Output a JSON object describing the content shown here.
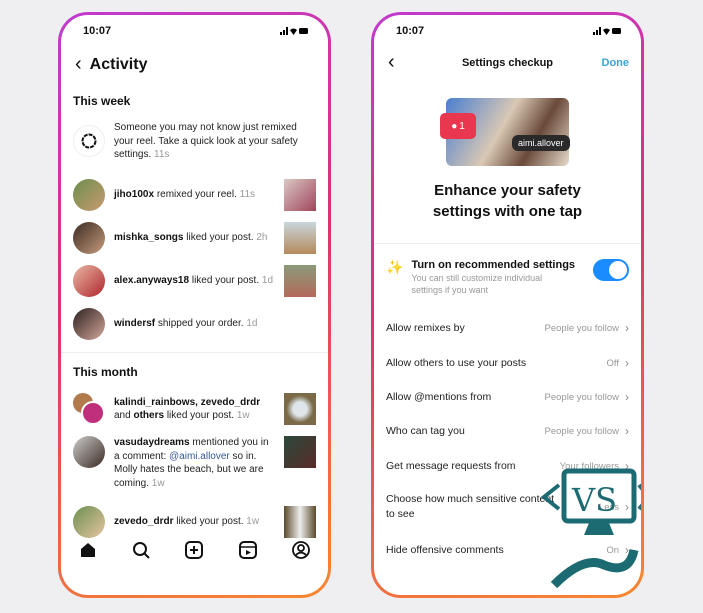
{
  "left": {
    "time": "10:07",
    "title": "Activity",
    "this_week": "This week",
    "items_week": [
      {
        "user": "",
        "text": "Someone you may not know just remixed your reel. Take a quick look at your safety settings.",
        "time": "11s"
      },
      {
        "user": "jiho100x",
        "text": "remixed your reel.",
        "time": "11s"
      },
      {
        "user": "mishka_songs",
        "text": "liked your post.",
        "time": "2h"
      },
      {
        "user": "alex.anyways18",
        "text": "liked your post.",
        "time": "1d"
      },
      {
        "user": "windersf",
        "text": "shipped your order.",
        "time": "1d"
      }
    ],
    "this_month": "This month",
    "items_month": [
      {
        "user": "kalindi_rainbows, zevedo_drdr",
        "mid": "and",
        "user2": "others",
        "text": "liked your post.",
        "time": "1w"
      },
      {
        "user": "vasudaydreams",
        "text": "mentioned you in a comment:",
        "mention": "@aimi.allover",
        "text2": "so in. Molly hates the beach, but we are coming.",
        "time": "1w"
      },
      {
        "user": "zevedo_drdr",
        "text": "liked your post.",
        "time": "1w"
      }
    ],
    "nav": [
      "home-icon",
      "search-icon",
      "create-icon",
      "reels-icon",
      "profile-icon"
    ]
  },
  "right": {
    "time": "10:07",
    "title": "Settings checkup",
    "done": "Done",
    "image_tag": "aimi.allover",
    "badge_count": "1",
    "headline": "Enhance your safety settings with one tap",
    "toggle_title": "Turn on recommended settings",
    "toggle_sub": "You can still customize individual settings if you want",
    "toggle_on": true,
    "accent": "#1a8cff",
    "rows": [
      {
        "label": "Allow remixes by",
        "value": "People you follow"
      },
      {
        "label": "Allow others to use your posts",
        "value": "Off"
      },
      {
        "label": "Allow @mentions from",
        "value": "People you follow"
      },
      {
        "label": "Who can tag you",
        "value": "People you follow"
      },
      {
        "label": "Get message requests from",
        "value": "Your followers"
      },
      {
        "label": "Choose how much sensitive content to see",
        "value": "Less"
      },
      {
        "label": "Hide offensive comments",
        "value": "On"
      }
    ]
  }
}
